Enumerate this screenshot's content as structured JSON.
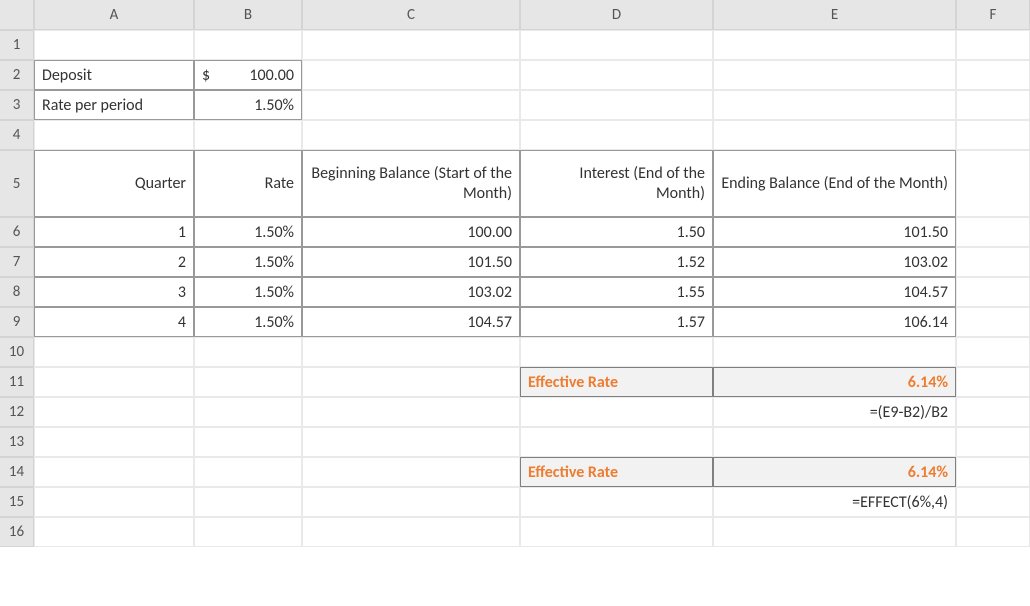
{
  "columns": [
    "A",
    "B",
    "C",
    "D",
    "E",
    "F"
  ],
  "row_numbers": [
    "1",
    "2",
    "3",
    "4",
    "5",
    "6",
    "7",
    "8",
    "9",
    "10",
    "11",
    "12",
    "13",
    "14",
    "15",
    "16"
  ],
  "inputs": {
    "deposit_label": "Deposit",
    "deposit_value_sym": "$",
    "deposit_value_num": "100.00",
    "rate_label": "Rate per period",
    "rate_value": "1.50%"
  },
  "headers": {
    "quarter": "Quarter",
    "rate": "Rate",
    "beginning": "Beginning Balance (Start of the Month)",
    "interest": "Interest\n(End of the Month)",
    "ending": "Ending Balance (End of the Month)"
  },
  "rows": [
    {
      "q": "1",
      "rate": "1.50%",
      "beg": "100.00",
      "int": "1.50",
      "end": "101.50"
    },
    {
      "q": "2",
      "rate": "1.50%",
      "beg": "101.50",
      "int": "1.52",
      "end": "103.02"
    },
    {
      "q": "3",
      "rate": "1.50%",
      "beg": "103.02",
      "int": "1.55",
      "end": "104.57"
    },
    {
      "q": "4",
      "rate": "1.50%",
      "beg": "104.57",
      "int": "1.57",
      "end": "106.14"
    }
  ],
  "effective1_label": "Effective Rate",
  "effective1_value": "6.14%",
  "formula1": "=(E9-B2)/B2",
  "effective2_label": "Effective Rate",
  "effective2_value": "6.14%",
  "formula2": "=EFFECT(6%,4)"
}
